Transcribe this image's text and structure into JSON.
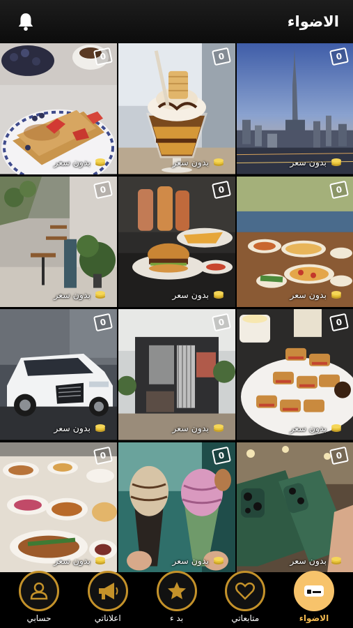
{
  "header": {
    "title": "الاضواء",
    "bell_icon": "bell-icon"
  },
  "tiles": [
    {
      "name": "crepe-breakfast",
      "badge": "0",
      "price": "بدون سعر"
    },
    {
      "name": "ice-cream-sundae",
      "badge": "0",
      "price": "بدون سعر"
    },
    {
      "name": "dubai-skyline",
      "badge": "0",
      "price": "بدون سعر"
    },
    {
      "name": "cafe-interior",
      "badge": "0",
      "price": "بدون سعر"
    },
    {
      "name": "burger-fries",
      "badge": "0",
      "price": "بدون سعر"
    },
    {
      "name": "restaurant-feast",
      "badge": "0",
      "price": "بدون سعر"
    },
    {
      "name": "white-suv",
      "badge": "0",
      "price": "بدون سعر"
    },
    {
      "name": "modern-building",
      "badge": "0",
      "price": "بدون سعر"
    },
    {
      "name": "pastry-plate",
      "badge": "0",
      "price": "بدون سعر"
    },
    {
      "name": "dinner-spread",
      "badge": "0",
      "price": "بدون سعر"
    },
    {
      "name": "ice-cream-cones",
      "badge": "0",
      "price": "بدون سعر"
    },
    {
      "name": "green-phones",
      "badge": "0",
      "price": "بدون سعر"
    }
  ],
  "nav": {
    "items": [
      {
        "label": "حسابي",
        "icon": "user-icon"
      },
      {
        "label": "اعلاناتي",
        "icon": "megaphone-icon"
      },
      {
        "label": "بد ء",
        "icon": "star-icon"
      },
      {
        "label": "متابعاتي",
        "icon": "heart-icon"
      },
      {
        "label": "الاضواء",
        "icon": "spotlight-icon",
        "active": true
      }
    ]
  },
  "colors": {
    "accent": "#c4922a",
    "active": "#f7c36b",
    "coin": "#e8c43a"
  }
}
